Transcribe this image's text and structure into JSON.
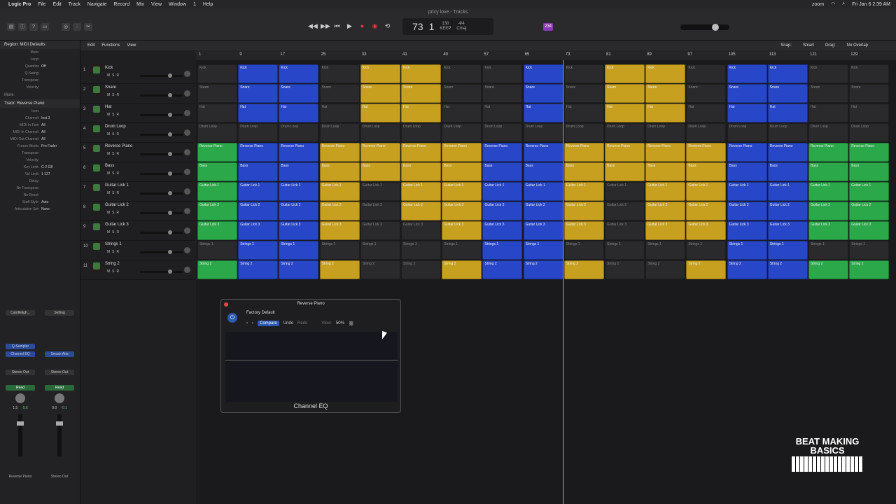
{
  "menubar": {
    "app_name": "Logic Pro",
    "items": [
      "File",
      "Edit",
      "Track",
      "Navigate",
      "Record",
      "Mix",
      "View",
      "Window",
      "1",
      "Help"
    ],
    "zoom_label": "zoom",
    "clock": "Fri Jan 6  2:39 AM"
  },
  "window": {
    "title": "pricy love - Tracks"
  },
  "lcd": {
    "bar": "73",
    "beat": "1",
    "tempo": "130",
    "keep": "KEEP",
    "signature": "4/4",
    "key": "Cmaj"
  },
  "count_badge": "234",
  "inspector": {
    "region_header": "Region: MIDI Defaults",
    "region_rows": [
      {
        "k": "Mute:",
        "v": ""
      },
      {
        "k": "Loop:",
        "v": ""
      },
      {
        "k": "Quantize",
        "v": "Off"
      },
      {
        "k": "Q-Swing:",
        "v": ""
      },
      {
        "k": "Transpose:",
        "v": ""
      },
      {
        "k": "Velocity:",
        "v": ""
      }
    ],
    "more_label": "More",
    "track_header": "Track: Reverse Piano",
    "track_rows": [
      {
        "k": "Icon:",
        "v": ""
      },
      {
        "k": "Channel:",
        "v": "Inst 3"
      },
      {
        "k": "MIDI In Port:",
        "v": "All"
      },
      {
        "k": "MIDI In Channel:",
        "v": "All"
      },
      {
        "k": "MIDI Out Channel:",
        "v": "All"
      },
      {
        "k": "Freeze Mode:",
        "v": "Pre Fader"
      },
      {
        "k": "Transpose:",
        "v": ""
      },
      {
        "k": "Velocity:",
        "v": ""
      },
      {
        "k": "Key Limit:",
        "v": "C-2  G8"
      },
      {
        "k": "Vel Limit:",
        "v": "1  127"
      },
      {
        "k": "Delay:",
        "v": ""
      },
      {
        "k": "No Transpose:",
        "v": ""
      },
      {
        "k": "No Reset:",
        "v": ""
      },
      {
        "k": "Staff Style:",
        "v": "Auto"
      },
      {
        "k": "Articulation Set:",
        "v": "None"
      }
    ],
    "strip1": {
      "setting": "Candleligh...",
      "slot1": "Q-Sampler",
      "slot2": "Channel EQ",
      "output": "Stereo Out",
      "mode": "Read",
      "val1": "1.5",
      "val2": "-5.6",
      "name": "Reverse Piano"
    },
    "strip2": {
      "setting": "Setting",
      "slot2": "Smack Atta",
      "output": "Stereo Out",
      "mode": "Read",
      "val1": "0.0",
      "val2": "-0.1",
      "name": "Stereo Out"
    }
  },
  "tracks_toolbar": {
    "edit": "Edit",
    "functions": "Functions",
    "view": "View",
    "snap_label": "Snap:",
    "snap_value": "Smart",
    "drag_label": "Drag:",
    "drag_value": "No Overlap"
  },
  "tracks": [
    {
      "num": "1",
      "name": "Kick"
    },
    {
      "num": "2",
      "name": "Snare"
    },
    {
      "num": "3",
      "name": "Hat"
    },
    {
      "num": "4",
      "name": "Drum Loop"
    },
    {
      "num": "5",
      "name": "Reverse Piano"
    },
    {
      "num": "6",
      "name": "Bass"
    },
    {
      "num": "7",
      "name": "Guitar Lick 1"
    },
    {
      "num": "8",
      "name": "Guitar Lick 2"
    },
    {
      "num": "9",
      "name": "Guitar Lick 3"
    },
    {
      "num": "10",
      "name": "Strings 1"
    },
    {
      "num": "11",
      "name": "String 2"
    }
  ],
  "ruler": [
    "1",
    "9",
    "17",
    "25",
    "33",
    "41",
    "49",
    "57",
    "65",
    "73",
    "81",
    "89",
    "97",
    "105",
    "113",
    "121",
    "129"
  ],
  "region_colors": [
    [
      "d",
      "b",
      "b",
      "d",
      "y",
      "y",
      "d",
      "d",
      "b",
      "d",
      "y",
      "y",
      "d",
      "b",
      "b",
      "d",
      "d"
    ],
    [
      "d",
      "b",
      "b",
      "d",
      "y",
      "y",
      "d",
      "d",
      "b",
      "d",
      "y",
      "y",
      "d",
      "b",
      "b",
      "d",
      "d"
    ],
    [
      "d",
      "b",
      "b",
      "d",
      "y",
      "y",
      "d",
      "d",
      "b",
      "d",
      "y",
      "y",
      "d",
      "b",
      "b",
      "d",
      "d"
    ],
    [
      "d",
      "d",
      "d",
      "d",
      "d",
      "d",
      "d",
      "d",
      "d",
      "d",
      "d",
      "d",
      "d",
      "d",
      "d",
      "d",
      "d"
    ],
    [
      "g",
      "b",
      "b",
      "y",
      "y",
      "y",
      "y",
      "b",
      "b",
      "y",
      "y",
      "y",
      "y",
      "b",
      "b",
      "g",
      "g"
    ],
    [
      "g",
      "b",
      "b",
      "y",
      "y",
      "y",
      "y",
      "b",
      "b",
      "y",
      "y",
      "y",
      "y",
      "b",
      "b",
      "g",
      "g"
    ],
    [
      "g",
      "b",
      "b",
      "y",
      "d",
      "y",
      "y",
      "b",
      "b",
      "y",
      "d",
      "y",
      "y",
      "b",
      "b",
      "g",
      "g"
    ],
    [
      "g",
      "b",
      "b",
      "y",
      "d",
      "y",
      "y",
      "b",
      "b",
      "y",
      "d",
      "y",
      "y",
      "b",
      "b",
      "g",
      "g"
    ],
    [
      "g",
      "b",
      "b",
      "y",
      "d",
      "d",
      "y",
      "b",
      "b",
      "y",
      "d",
      "y",
      "y",
      "b",
      "b",
      "g",
      "g"
    ],
    [
      "d",
      "b",
      "b",
      "d",
      "d",
      "d",
      "d",
      "b",
      "b",
      "d",
      "d",
      "d",
      "d",
      "b",
      "b",
      "d",
      "d"
    ],
    [
      "g",
      "b",
      "b",
      "y",
      "d",
      "d",
      "y",
      "b",
      "b",
      "y",
      "d",
      "d",
      "y",
      "b",
      "b",
      "g",
      "g"
    ]
  ],
  "plugin": {
    "title": "Reverse Piano",
    "preset": "Factory Default",
    "compare": "Compare",
    "undo": "Undo",
    "redo": "Redo",
    "view_label": "View:",
    "view_value": "50%",
    "name": "Channel EQ"
  },
  "watermark": {
    "line1": "BEAT MAKING",
    "line2": "BASICS"
  }
}
